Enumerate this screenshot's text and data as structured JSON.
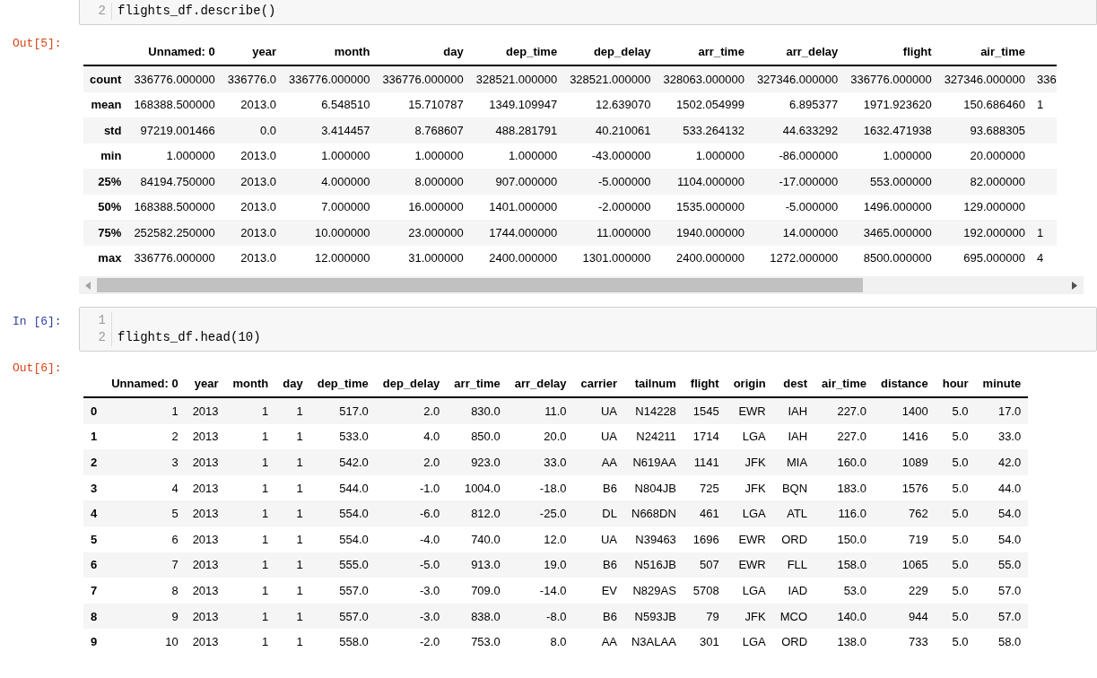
{
  "cells": [
    {
      "kind": "code",
      "lines": [
        {
          "number": "2",
          "code": "flights_df.describe()"
        }
      ],
      "cut_top": true
    },
    {
      "kind": "output",
      "prompt": "Out[5]:",
      "table": {
        "scrollable": true,
        "columns": [
          "Unnamed: 0",
          "year",
          "month",
          "day",
          "dep_time",
          "dep_delay",
          "arr_time",
          "arr_delay",
          "flight",
          "air_time"
        ],
        "rows": [
          {
            "label": "count",
            "cells": [
              "336776.000000",
              "336776.0",
              "336776.000000",
              "336776.000000",
              "328521.000000",
              "328521.000000",
              "328063.000000",
              "327346.000000",
              "336776.000000",
              "327346.000000"
            ],
            "clipped": "336"
          },
          {
            "label": "mean",
            "cells": [
              "168388.500000",
              "2013.0",
              "6.548510",
              "15.710787",
              "1349.109947",
              "12.639070",
              "1502.054999",
              "6.895377",
              "1971.923620",
              "150.686460"
            ],
            "clipped": "1"
          },
          {
            "label": "std",
            "cells": [
              "97219.001466",
              "0.0",
              "3.414457",
              "8.768607",
              "488.281791",
              "40.210061",
              "533.264132",
              "44.633292",
              "1632.471938",
              "93.688305"
            ]
          },
          {
            "label": "min",
            "cells": [
              "1.000000",
              "2013.0",
              "1.000000",
              "1.000000",
              "1.000000",
              "-43.000000",
              "1.000000",
              "-86.000000",
              "1.000000",
              "20.000000"
            ]
          },
          {
            "label": "25%",
            "cells": [
              "84194.750000",
              "2013.0",
              "4.000000",
              "8.000000",
              "907.000000",
              "-5.000000",
              "1104.000000",
              "-17.000000",
              "553.000000",
              "82.000000"
            ]
          },
          {
            "label": "50%",
            "cells": [
              "168388.500000",
              "2013.0",
              "7.000000",
              "16.000000",
              "1401.000000",
              "-2.000000",
              "1535.000000",
              "-5.000000",
              "1496.000000",
              "129.000000"
            ]
          },
          {
            "label": "75%",
            "cells": [
              "252582.250000",
              "2013.0",
              "10.000000",
              "23.000000",
              "1744.000000",
              "11.000000",
              "1940.000000",
              "14.000000",
              "3465.000000",
              "192.000000"
            ],
            "clipped": "1"
          },
          {
            "label": "max",
            "cells": [
              "336776.000000",
              "2013.0",
              "12.000000",
              "31.000000",
              "2400.000000",
              "1301.000000",
              "2400.000000",
              "1272.000000",
              "8500.000000",
              "695.000000"
            ],
            "clipped": "4"
          }
        ]
      }
    },
    {
      "kind": "code",
      "prompt": "In [6]:",
      "lines": [
        {
          "number": "1"
        },
        {
          "number": "2",
          "code": "flights_df.head(10)"
        }
      ],
      "cut_top": false
    },
    {
      "kind": "output",
      "prompt": "Out[6]:",
      "table": {
        "scrollable": false,
        "columns": [
          "Unnamed: 0",
          "year",
          "month",
          "day",
          "dep_time",
          "dep_delay",
          "arr_time",
          "arr_delay",
          "carrier",
          "tailnum",
          "flight",
          "origin",
          "dest",
          "air_time",
          "distance",
          "hour",
          "minute"
        ],
        "rows": [
          {
            "label": "0",
            "cells": [
              "1",
              "2013",
              "1",
              "1",
              "517.0",
              "2.0",
              "830.0",
              "11.0",
              "UA",
              "N14228",
              "1545",
              "EWR",
              "IAH",
              "227.0",
              "1400",
              "5.0",
              "17.0"
            ]
          },
          {
            "label": "1",
            "cells": [
              "2",
              "2013",
              "1",
              "1",
              "533.0",
              "4.0",
              "850.0",
              "20.0",
              "UA",
              "N24211",
              "1714",
              "LGA",
              "IAH",
              "227.0",
              "1416",
              "5.0",
              "33.0"
            ]
          },
          {
            "label": "2",
            "cells": [
              "3",
              "2013",
              "1",
              "1",
              "542.0",
              "2.0",
              "923.0",
              "33.0",
              "AA",
              "N619AA",
              "1141",
              "JFK",
              "MIA",
              "160.0",
              "1089",
              "5.0",
              "42.0"
            ]
          },
          {
            "label": "3",
            "cells": [
              "4",
              "2013",
              "1",
              "1",
              "544.0",
              "-1.0",
              "1004.0",
              "-18.0",
              "B6",
              "N804JB",
              "725",
              "JFK",
              "BQN",
              "183.0",
              "1576",
              "5.0",
              "44.0"
            ]
          },
          {
            "label": "4",
            "cells": [
              "5",
              "2013",
              "1",
              "1",
              "554.0",
              "-6.0",
              "812.0",
              "-25.0",
              "DL",
              "N668DN",
              "461",
              "LGA",
              "ATL",
              "116.0",
              "762",
              "5.0",
              "54.0"
            ]
          },
          {
            "label": "5",
            "cells": [
              "6",
              "2013",
              "1",
              "1",
              "554.0",
              "-4.0",
              "740.0",
              "12.0",
              "UA",
              "N39463",
              "1696",
              "EWR",
              "ORD",
              "150.0",
              "719",
              "5.0",
              "54.0"
            ]
          },
          {
            "label": "6",
            "cells": [
              "7",
              "2013",
              "1",
              "1",
              "555.0",
              "-5.0",
              "913.0",
              "19.0",
              "B6",
              "N516JB",
              "507",
              "EWR",
              "FLL",
              "158.0",
              "1065",
              "5.0",
              "55.0"
            ]
          },
          {
            "label": "7",
            "cells": [
              "8",
              "2013",
              "1",
              "1",
              "557.0",
              "-3.0",
              "709.0",
              "-14.0",
              "EV",
              "N829AS",
              "5708",
              "LGA",
              "IAD",
              "53.0",
              "229",
              "5.0",
              "57.0"
            ]
          },
          {
            "label": "8",
            "cells": [
              "9",
              "2013",
              "1",
              "1",
              "557.0",
              "-3.0",
              "838.0",
              "-8.0",
              "B6",
              "N593JB",
              "79",
              "JFK",
              "MCO",
              "140.0",
              "944",
              "5.0",
              "57.0"
            ]
          },
          {
            "label": "9",
            "cells": [
              "10",
              "2013",
              "1",
              "1",
              "558.0",
              "-2.0",
              "753.0",
              "8.0",
              "AA",
              "N3ALAA",
              "301",
              "LGA",
              "ORD",
              "138.0",
              "733",
              "5.0",
              "58.0"
            ]
          }
        ]
      }
    }
  ]
}
